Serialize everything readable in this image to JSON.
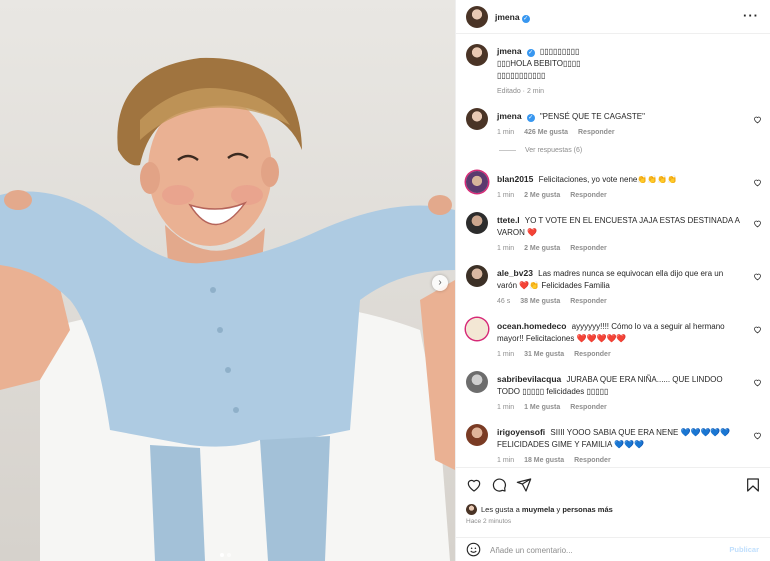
{
  "post": {
    "author": "jmena",
    "caption_lines": [
      "▯▯▯▯▯▯▯▯▯",
      "▯▯▯HOLA BEBITO▯▯▯▯",
      "▯▯▯▯▯▯▯▯▯▯▯"
    ],
    "edited": "Editado · 2 min"
  },
  "icons": {
    "more": "more-icon",
    "verified": "verified-badge-icon",
    "like": "heart-icon",
    "comment": "comment-icon",
    "share": "share-icon",
    "save": "bookmark-icon",
    "emoji": "emoji-icon",
    "next": "chevron-right-icon"
  },
  "comments": [
    {
      "user": "jmena",
      "verified": true,
      "text": "\"PENSÉ QUE TE CAGASTE\"",
      "time": "1 min",
      "likes": "426 Me gusta",
      "reply": "Responder"
    },
    {
      "user": "blan2015",
      "text": "Felicitaciones, yo vote nene👏👏👏👏",
      "time": "1 min",
      "likes": "2 Me gusta",
      "reply": "Responder"
    },
    {
      "user": "ttete.l",
      "text": "YO T VOTE EN EL ENCUESTA JAJA ESTAS DESTINADA A VARON ❤️",
      "time": "1 min",
      "likes": "2 Me gusta",
      "reply": "Responder"
    },
    {
      "user": "ale_bv23",
      "text": "Las madres nunca se equivocan ella dijo que era un varón ❤️👏 Felicidades Familia",
      "time": "46 s",
      "likes": "38 Me gusta",
      "reply": "Responder"
    },
    {
      "user": "ocean.homedeco",
      "text": "ayyyyyy!!!! Cómo lo va a seguir al hermano mayor!! Felicitaciones ❤️❤️❤️❤️❤️",
      "time": "1 min",
      "likes": "31 Me gusta",
      "reply": "Responder"
    },
    {
      "user": "sabribevilacqua",
      "text": "JURABA QUE ERA NIÑA...... QUE LINDOO TODO ▯▯▯▯▯ felicidades ▯▯▯▯▯",
      "time": "1 min",
      "likes": "1 Me gusta",
      "reply": "Responder"
    },
    {
      "user": "irigoyensofi",
      "text": "SIIII YOOO SABIA QUE ERA NENE 💙💙💙💙💙 FELICIDADES GIME Y FAMILIA 💙💙💙",
      "time": "1 min",
      "likes": "18 Me gusta",
      "reply": "Responder"
    }
  ],
  "view_replies": "Ver respuestas (6)",
  "liked_by": {
    "prefix": "Les gusta a",
    "user": "muymela",
    "middle": "y",
    "others": "personas más"
  },
  "posted_ago": "Hace 2 minutos",
  "add_comment": {
    "placeholder": "Añade un comentario...",
    "publish": "Publicar"
  },
  "colors": {
    "verified": "#3897f0",
    "border": "#efefef",
    "muted": "#8e8e8e",
    "heart": "#ed4956"
  }
}
